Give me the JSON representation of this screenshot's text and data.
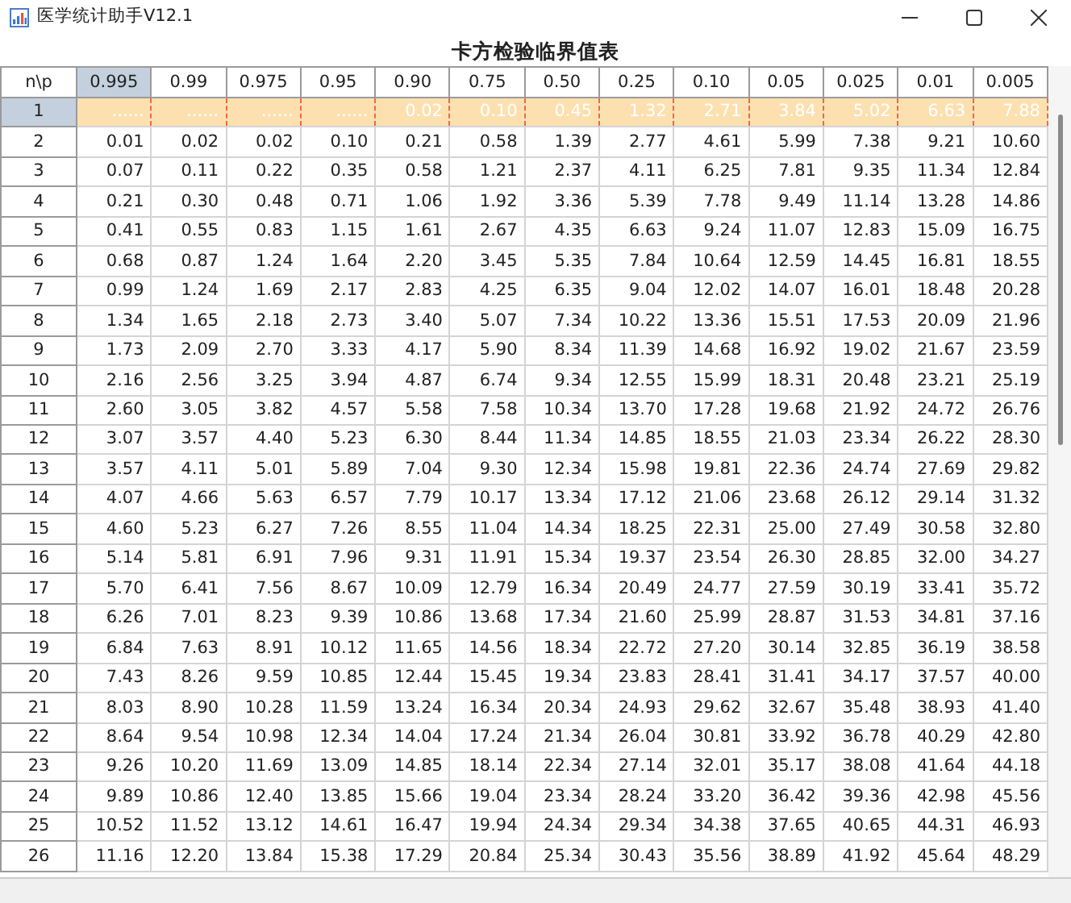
{
  "window": {
    "title": "医学统计助手V12.1"
  },
  "table": {
    "title": "卡方检验临界值表",
    "corner": "n\\p",
    "columns": [
      {
        "label": "0.995",
        "selected": true
      },
      {
        "label": "0.99",
        "selected": false
      },
      {
        "label": "0.975",
        "selected": false
      },
      {
        "label": "0.95",
        "selected": false
      },
      {
        "label": "0.90",
        "selected": false
      },
      {
        "label": "0.75",
        "selected": false
      },
      {
        "label": "0.50",
        "selected": false
      },
      {
        "label": "0.25",
        "selected": false
      },
      {
        "label": "0.10",
        "selected": false
      },
      {
        "label": "0.05",
        "selected": false
      },
      {
        "label": "0.025",
        "selected": false
      },
      {
        "label": "0.01",
        "selected": false
      },
      {
        "label": "0.005",
        "selected": false
      }
    ],
    "rows": [
      {
        "label": "1",
        "selected": true,
        "cells": [
          "......",
          "......",
          "......",
          "......",
          "0.02",
          "0.10",
          "0.45",
          "1.32",
          "2.71",
          "3.84",
          "5.02",
          "6.63",
          "7.88"
        ]
      },
      {
        "label": "2",
        "selected": false,
        "cells": [
          "0.01",
          "0.02",
          "0.02",
          "0.10",
          "0.21",
          "0.58",
          "1.39",
          "2.77",
          "4.61",
          "5.99",
          "7.38",
          "9.21",
          "10.60"
        ]
      },
      {
        "label": "3",
        "selected": false,
        "cells": [
          "0.07",
          "0.11",
          "0.22",
          "0.35",
          "0.58",
          "1.21",
          "2.37",
          "4.11",
          "6.25",
          "7.81",
          "9.35",
          "11.34",
          "12.84"
        ]
      },
      {
        "label": "4",
        "selected": false,
        "cells": [
          "0.21",
          "0.30",
          "0.48",
          "0.71",
          "1.06",
          "1.92",
          "3.36",
          "5.39",
          "7.78",
          "9.49",
          "11.14",
          "13.28",
          "14.86"
        ]
      },
      {
        "label": "5",
        "selected": false,
        "cells": [
          "0.41",
          "0.55",
          "0.83",
          "1.15",
          "1.61",
          "2.67",
          "4.35",
          "6.63",
          "9.24",
          "11.07",
          "12.83",
          "15.09",
          "16.75"
        ]
      },
      {
        "label": "6",
        "selected": false,
        "cells": [
          "0.68",
          "0.87",
          "1.24",
          "1.64",
          "2.20",
          "3.45",
          "5.35",
          "7.84",
          "10.64",
          "12.59",
          "14.45",
          "16.81",
          "18.55"
        ]
      },
      {
        "label": "7",
        "selected": false,
        "cells": [
          "0.99",
          "1.24",
          "1.69",
          "2.17",
          "2.83",
          "4.25",
          "6.35",
          "9.04",
          "12.02",
          "14.07",
          "16.01",
          "18.48",
          "20.28"
        ]
      },
      {
        "label": "8",
        "selected": false,
        "cells": [
          "1.34",
          "1.65",
          "2.18",
          "2.73",
          "3.40",
          "5.07",
          "7.34",
          "10.22",
          "13.36",
          "15.51",
          "17.53",
          "20.09",
          "21.96"
        ]
      },
      {
        "label": "9",
        "selected": false,
        "cells": [
          "1.73",
          "2.09",
          "2.70",
          "3.33",
          "4.17",
          "5.90",
          "8.34",
          "11.39",
          "14.68",
          "16.92",
          "19.02",
          "21.67",
          "23.59"
        ]
      },
      {
        "label": "10",
        "selected": false,
        "cells": [
          "2.16",
          "2.56",
          "3.25",
          "3.94",
          "4.87",
          "6.74",
          "9.34",
          "12.55",
          "15.99",
          "18.31",
          "20.48",
          "23.21",
          "25.19"
        ]
      },
      {
        "label": "11",
        "selected": false,
        "cells": [
          "2.60",
          "3.05",
          "3.82",
          "4.57",
          "5.58",
          "7.58",
          "10.34",
          "13.70",
          "17.28",
          "19.68",
          "21.92",
          "24.72",
          "26.76"
        ]
      },
      {
        "label": "12",
        "selected": false,
        "cells": [
          "3.07",
          "3.57",
          "4.40",
          "5.23",
          "6.30",
          "8.44",
          "11.34",
          "14.85",
          "18.55",
          "21.03",
          "23.34",
          "26.22",
          "28.30"
        ]
      },
      {
        "label": "13",
        "selected": false,
        "cells": [
          "3.57",
          "4.11",
          "5.01",
          "5.89",
          "7.04",
          "9.30",
          "12.34",
          "15.98",
          "19.81",
          "22.36",
          "24.74",
          "27.69",
          "29.82"
        ]
      },
      {
        "label": "14",
        "selected": false,
        "cells": [
          "4.07",
          "4.66",
          "5.63",
          "6.57",
          "7.79",
          "10.17",
          "13.34",
          "17.12",
          "21.06",
          "23.68",
          "26.12",
          "29.14",
          "31.32"
        ]
      },
      {
        "label": "15",
        "selected": false,
        "cells": [
          "4.60",
          "5.23",
          "6.27",
          "7.26",
          "8.55",
          "11.04",
          "14.34",
          "18.25",
          "22.31",
          "25.00",
          "27.49",
          "30.58",
          "32.80"
        ]
      },
      {
        "label": "16",
        "selected": false,
        "cells": [
          "5.14",
          "5.81",
          "6.91",
          "7.96",
          "9.31",
          "11.91",
          "15.34",
          "19.37",
          "23.54",
          "26.30",
          "28.85",
          "32.00",
          "34.27"
        ]
      },
      {
        "label": "17",
        "selected": false,
        "cells": [
          "5.70",
          "6.41",
          "7.56",
          "8.67",
          "10.09",
          "12.79",
          "16.34",
          "20.49",
          "24.77",
          "27.59",
          "30.19",
          "33.41",
          "35.72"
        ]
      },
      {
        "label": "18",
        "selected": false,
        "cells": [
          "6.26",
          "7.01",
          "8.23",
          "9.39",
          "10.86",
          "13.68",
          "17.34",
          "21.60",
          "25.99",
          "28.87",
          "31.53",
          "34.81",
          "37.16"
        ]
      },
      {
        "label": "19",
        "selected": false,
        "cells": [
          "6.84",
          "7.63",
          "8.91",
          "10.12",
          "11.65",
          "14.56",
          "18.34",
          "22.72",
          "27.20",
          "30.14",
          "32.85",
          "36.19",
          "38.58"
        ]
      },
      {
        "label": "20",
        "selected": false,
        "cells": [
          "7.43",
          "8.26",
          "9.59",
          "10.85",
          "12.44",
          "15.45",
          "19.34",
          "23.83",
          "28.41",
          "31.41",
          "34.17",
          "37.57",
          "40.00"
        ]
      },
      {
        "label": "21",
        "selected": false,
        "cells": [
          "8.03",
          "8.90",
          "10.28",
          "11.59",
          "13.24",
          "16.34",
          "20.34",
          "24.93",
          "29.62",
          "32.67",
          "35.48",
          "38.93",
          "41.40"
        ]
      },
      {
        "label": "22",
        "selected": false,
        "cells": [
          "8.64",
          "9.54",
          "10.98",
          "12.34",
          "14.04",
          "17.24",
          "21.34",
          "26.04",
          "30.81",
          "33.92",
          "36.78",
          "40.29",
          "42.80"
        ]
      },
      {
        "label": "23",
        "selected": false,
        "cells": [
          "9.26",
          "10.20",
          "11.69",
          "13.09",
          "14.85",
          "18.14",
          "22.34",
          "27.14",
          "32.01",
          "35.17",
          "38.08",
          "41.64",
          "44.18"
        ]
      },
      {
        "label": "24",
        "selected": false,
        "cells": [
          "9.89",
          "10.86",
          "12.40",
          "13.85",
          "15.66",
          "19.04",
          "23.34",
          "28.24",
          "33.20",
          "36.42",
          "39.36",
          "42.98",
          "45.56"
        ]
      },
      {
        "label": "25",
        "selected": false,
        "cells": [
          "10.52",
          "11.52",
          "13.12",
          "14.61",
          "16.47",
          "19.94",
          "24.34",
          "29.34",
          "34.38",
          "37.65",
          "40.65",
          "44.31",
          "46.93"
        ]
      },
      {
        "label": "26",
        "selected": false,
        "cells": [
          "11.16",
          "12.20",
          "13.84",
          "15.38",
          "17.29",
          "20.84",
          "25.34",
          "30.43",
          "35.56",
          "38.89",
          "41.92",
          "45.64",
          "48.29"
        ]
      }
    ]
  }
}
